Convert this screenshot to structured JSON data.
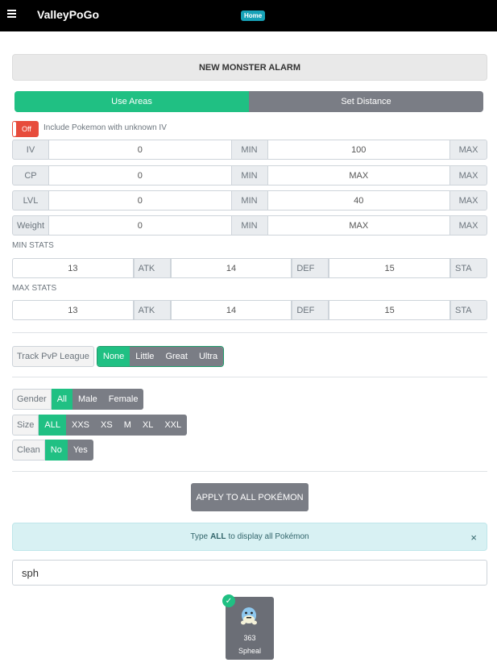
{
  "navbar": {
    "brand": "ValleyPoGo",
    "home_badge": "Home"
  },
  "header": {
    "title": "NEW MONSTER ALARM"
  },
  "mode": {
    "use_areas": "Use Areas",
    "set_distance": "Set Distance"
  },
  "unknown_iv": {
    "toggle_label": "Off",
    "label": "Include Pokemon with unknown IV"
  },
  "ranges": [
    {
      "label": "IV",
      "min": "0",
      "max": "100",
      "min_tag": "MIN",
      "max_tag": "MAX"
    },
    {
      "label": "CP",
      "min": "0",
      "max_placeholder": "MAX",
      "min_tag": "MIN",
      "max_tag": "MAX"
    },
    {
      "label": "LVL",
      "min": "0",
      "max": "40",
      "min_tag": "MIN",
      "max_tag": "MAX"
    },
    {
      "label": "Weight",
      "min": "0",
      "max_placeholder": "MAX",
      "min_tag": "MIN",
      "max_tag": "MAX"
    }
  ],
  "min_stats": {
    "label": "MIN STATS",
    "atk": "13",
    "def": "14",
    "sta": "15",
    "atk_tag": "ATK",
    "def_tag": "DEF",
    "sta_tag": "STA"
  },
  "max_stats": {
    "label": "MAX STATS",
    "atk": "13",
    "def": "14",
    "sta": "15",
    "atk_tag": "ATK",
    "def_tag": "DEF",
    "sta_tag": "STA"
  },
  "pvp": {
    "label": "Track PvP League",
    "options": [
      "None",
      "Little",
      "Great",
      "Ultra"
    ],
    "selected": "None"
  },
  "gender": {
    "label": "Gender",
    "options": [
      "All",
      "Male",
      "Female"
    ],
    "selected": "All"
  },
  "size": {
    "label": "Size",
    "options": [
      "ALL",
      "XXS",
      "XS",
      "M",
      "XL",
      "XXL"
    ],
    "selected": "ALL"
  },
  "clean": {
    "label": "Clean",
    "options": [
      "No",
      "Yes"
    ],
    "selected": "No"
  },
  "apply_button": "APPLY TO ALL POKÉMON",
  "info": {
    "prefix": "Type",
    "keyword": "ALL",
    "suffix": "to display all Pokémon",
    "close": "×"
  },
  "search": {
    "value": "sph"
  },
  "pokemon": [
    {
      "number": "363",
      "name": "Spheal",
      "selected": true
    }
  ],
  "colors": {
    "accent": "#20c083",
    "inactive": "#7a7d85",
    "off": "#e74c3c",
    "badge": "#17a2b8"
  }
}
